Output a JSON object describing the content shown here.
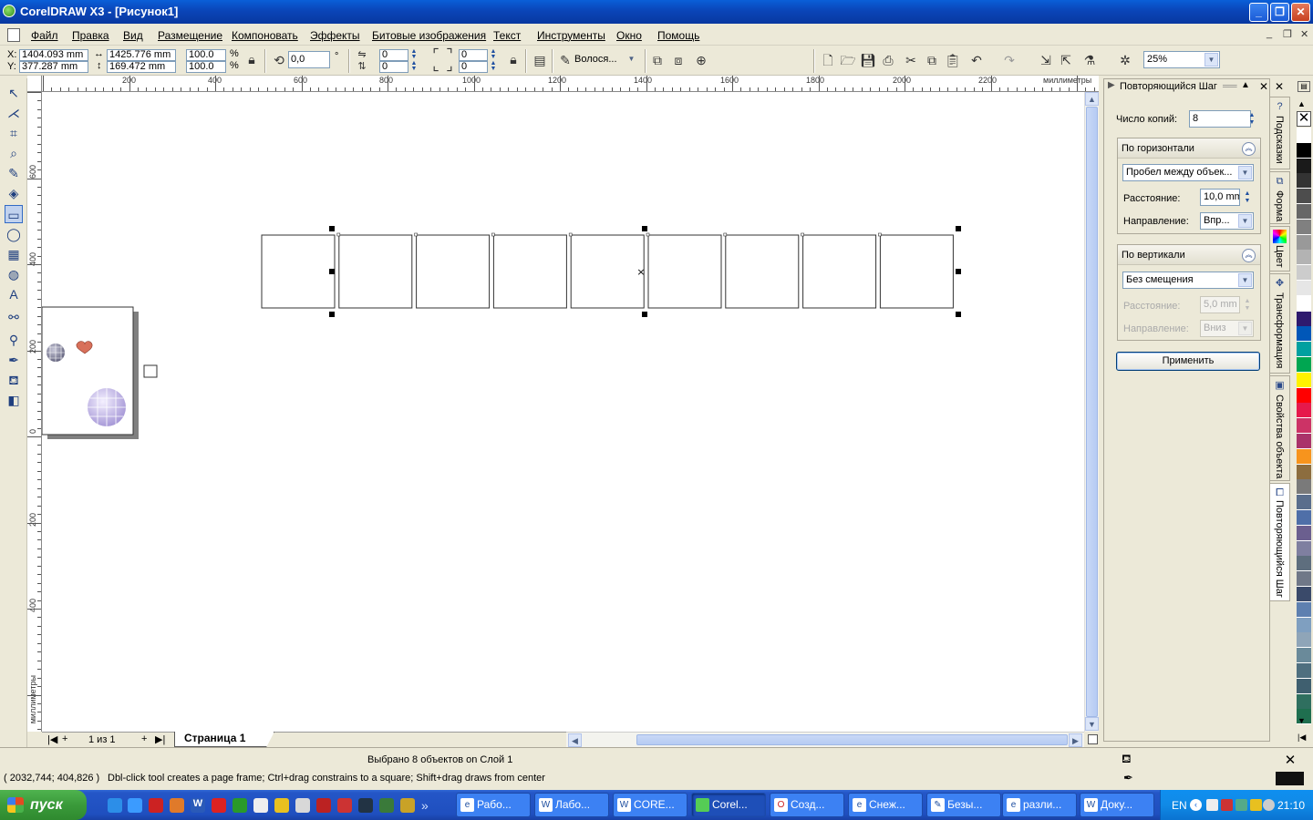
{
  "window": {
    "title": "CorelDRAW X3 - [Рисунок1]"
  },
  "menu": [
    "Файл",
    "Правка",
    "Вид",
    "Размещение",
    "Компоновать",
    "Эффекты",
    "Битовые изображения",
    "Текст",
    "Инструменты",
    "Окно",
    "Помощь"
  ],
  "propbar": {
    "x_label": "X:",
    "x_value": "1404.093 mm",
    "y_label": "Y:",
    "y_value": "377.287 mm",
    "w_value": "1425.776 mm",
    "h_value": "169.472 mm",
    "scale_w": "100.0",
    "scale_h": "100.0",
    "pct1": "%",
    "pct2": "%",
    "rotation": "0,0",
    "deg": "°",
    "corner1": "0",
    "corner2": "0",
    "corner3": "0",
    "corner4": "0",
    "outline": "Волося...",
    "zoom": "25%"
  },
  "ruler": {
    "unit": "миллиметры",
    "h_ticks": [
      "200",
      "400",
      "600",
      "800",
      "1000",
      "1200",
      "1400",
      "1600",
      "1800",
      "2000",
      "2200"
    ],
    "v_ticks": [
      "600",
      "400",
      "200",
      "0",
      "200",
      "400"
    ],
    "v_unit": "миллиметры"
  },
  "navigator": {
    "page_count": "1 из 1",
    "page_tab": "Страница 1"
  },
  "docker": {
    "title": "Повторяющийся Шаг",
    "copies_label": "Число копий:",
    "copies_value": "8",
    "horizontal": {
      "header": "По горизонтали",
      "mode": "Пробел между объек...",
      "distance_label": "Расстояние:",
      "distance_value": "10,0 mm",
      "direction_label": "Направление:",
      "direction_value": "Впр..."
    },
    "vertical": {
      "header": "По вертикали",
      "mode": "Без смещения",
      "distance_label": "Расстояние:",
      "distance_value": "5,0 mm",
      "direction_label": "Направление:",
      "direction_value": "Вниз"
    },
    "apply": "Применить"
  },
  "docker_tabs": [
    "Подсказки",
    "Форма",
    "Цвет",
    "Трансформация",
    "Свойства объекта",
    "Повторяющийся Шаг"
  ],
  "status": {
    "selection": "Выбрано 8 объектов on Слой 1",
    "coords": "( 2032,744; 404,826 )",
    "hint": "Dbl-click tool creates a page frame; Ctrl+drag constrains to a square; Shift+drag draws from center"
  },
  "palette_colors": [
    "#ffffff",
    "#000000",
    "#1a1a1a",
    "#333333",
    "#4d4d4d",
    "#666666",
    "#808080",
    "#999999",
    "#b3b3b3",
    "#cccccc",
    "#e6e6e6",
    "#ffffff",
    "#2e1a6e",
    "#0057b8",
    "#00a0a0",
    "#00a651",
    "#fff200",
    "#ff0000",
    "#e6194b",
    "#cc3366",
    "#aa336a",
    "#f7941d",
    "#8c6d3f",
    "#7a7a7a",
    "#5a6e8c",
    "#4f6fa8",
    "#6b5f8f",
    "#7f7fa0",
    "#5e6e7e",
    "#707888",
    "#3a4a6a",
    "#5e80b0",
    "#7f9fc0",
    "#8fa5b8",
    "#6a8a9a",
    "#4f6f7f",
    "#3f5f6f",
    "#2f6f5f",
    "#1f6f4f"
  ],
  "taskbar": {
    "start": "пуск",
    "tasks": [
      "Рабо...",
      "Лабо...",
      "CORE...",
      "Corel...",
      "Созд...",
      "Снеж...",
      "Безы...",
      "разли...",
      "Доку..."
    ],
    "lang": "EN",
    "clock": "21:10"
  }
}
